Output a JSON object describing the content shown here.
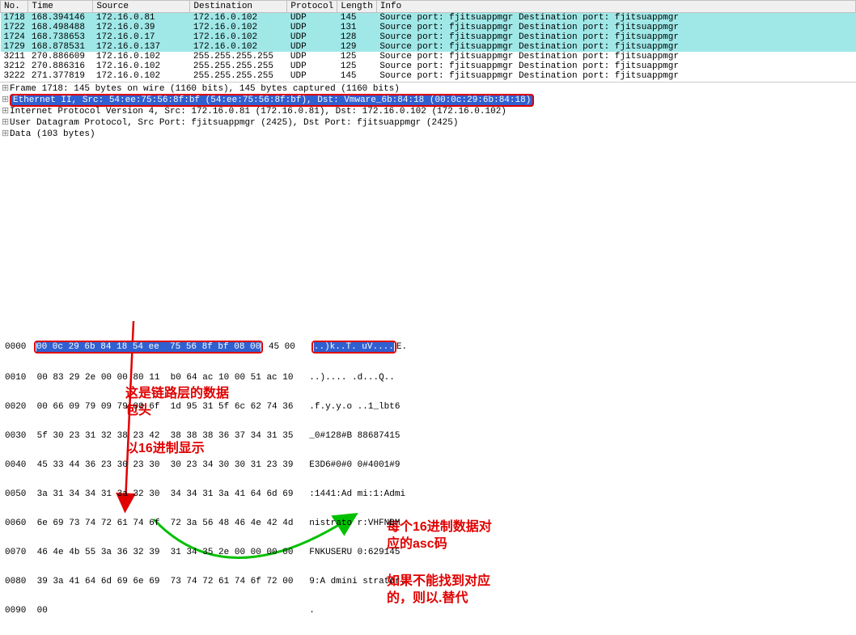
{
  "columns": {
    "no": "No.",
    "time": "Time",
    "source": "Source",
    "destination": "Destination",
    "protocol": "Protocol",
    "length": "Length",
    "info": "Info"
  },
  "packets": [
    {
      "no": "1718",
      "time": "168.394146",
      "src": "172.16.0.81",
      "dst": "172.16.0.102",
      "proto": "UDP",
      "len": "145",
      "info": "Source port: fjitsuappmgr  Destination port: fjitsuappmgr",
      "hl": true
    },
    {
      "no": "1722",
      "time": "168.498488",
      "src": "172.16.0.39",
      "dst": "172.16.0.102",
      "proto": "UDP",
      "len": "131",
      "info": "Source port: fjitsuappmgr  Destination port: fjitsuappmgr",
      "hl": true
    },
    {
      "no": "1724",
      "time": "168.738653",
      "src": "172.16.0.17",
      "dst": "172.16.0.102",
      "proto": "UDP",
      "len": "128",
      "info": "Source port: fjitsuappmgr  Destination port: fjitsuappmgr",
      "hl": true
    },
    {
      "no": "1729",
      "time": "168.878531",
      "src": "172.16.0.137",
      "dst": "172.16.0.102",
      "proto": "UDP",
      "len": "129",
      "info": "Source port: fjitsuappmgr  Destination port: fjitsuappmgr",
      "hl": true
    },
    {
      "no": "3211",
      "time": "270.886609",
      "src": "172.16.0.102",
      "dst": "255.255.255.255",
      "proto": "UDP",
      "len": "125",
      "info": "Source port: fjitsuappmgr  Destination port: fjitsuappmgr",
      "hl": false
    },
    {
      "no": "3212",
      "time": "270.886316",
      "src": "172.16.0.102",
      "dst": "255.255.255.255",
      "proto": "UDP",
      "len": "125",
      "info": "Source port: fjitsuappmgr  Destination port: fjitsuappmgr",
      "hl": false
    },
    {
      "no": "3222",
      "time": "271.377819",
      "src": "172.16.0.102",
      "dst": "255.255.255.255",
      "proto": "UDP",
      "len": "145",
      "info": "Source port: fjitsuappmgr  Destination port: fjitsuappmgr",
      "hl": false
    }
  ],
  "details": {
    "frame": "Frame 1718: 145 bytes on wire (1160 bits), 145 bytes captured (1160 bits)",
    "eth": "Ethernet II, Src: 54:ee:75:56:8f:bf (54:ee:75:56:8f:bf), Dst: Vmware_6b:84:18 (00:0c:29:6b:84:18)",
    "ip": "Internet Protocol Version 4, Src: 172.16.0.81 (172.16.0.81), Dst: 172.16.0.102 (172.16.0.102)",
    "udp": "User Datagram Protocol, Src Port: fjitsuappmgr (2425), Dst Port: fjitsuappmgr (2425)",
    "data": "Data (103 bytes)"
  },
  "annotations": {
    "a1": "这是链路层的数据包头",
    "a2": "以16进制显示",
    "a3": "每个16进制数据对应的asc码",
    "a4": "如果不能找到对应的，则以.替代"
  },
  "hex": {
    "line0_off": "0000",
    "line0_sel": "00 0c 29 6b 84 18 54 ee  75 56 8f bf 08 00",
    "line0_rest": " 45 00",
    "line0_asc_sel": "..)k..T. uV....",
    "line0_asc_rest": "E.",
    "line1": "0010  00 83 29 2e 00 00 80 11  b0 64 ac 10 00 51 ac 10   ..).... .d...Q..",
    "line2": "0020  00 66 09 79 09 79 00 6f  1d 95 31 5f 6c 62 74 36   .f.y.y.o ..1_lbt6",
    "line3": "0030  5f 30 23 31 32 38 23 42  38 38 38 36 37 34 31 35   _0#128#B 88687415",
    "line4": "0040  45 33 44 36 23 30 23 30  30 23 34 30 30 31 23 39   E3D6#0#0 0#4001#9",
    "line5": "0050  3a 31 34 34 31 3a 32 30  34 34 31 3a 41 64 6d 69   :1441:Ad mi:1:Admi",
    "line6": "0060  6e 69 73 74 72 61 74 6f  72 3a 56 48 46 4e 42 4d   nistrato r:VHFNBM",
    "line7": "0070  46 4e 4b 55 3a 36 32 39  31 34 35 2e 00 00 00 00   FNKUSERU 0:629145",
    "line8": "0080  39 3a 41 64 6d 69 6e 69  73 74 72 61 74 6f 72 00   9:A dmini strator.",
    "line9": "0090  00                                                 ."
  }
}
